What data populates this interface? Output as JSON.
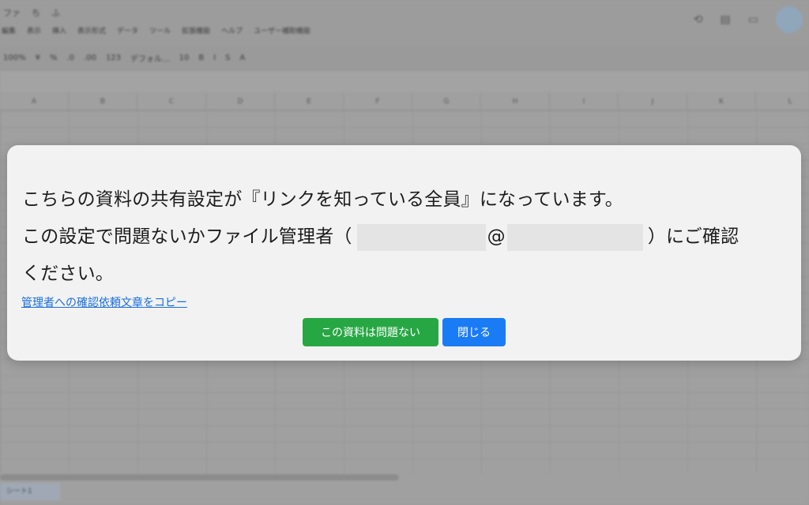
{
  "background": {
    "title_row": [
      "ファ",
      "ち",
      "ふ"
    ],
    "menu": [
      "編集",
      "表示",
      "挿入",
      "表示形式",
      "データ",
      "ツール",
      "拡張機能",
      "ヘルプ",
      "ユーザー補助機能"
    ],
    "toolbar": [
      "100%",
      "¥",
      "%",
      ".0",
      ".00",
      "123",
      "デフォル...",
      "10",
      "B",
      "I",
      "S",
      "A"
    ],
    "column_headers": [
      "A",
      "B",
      "C",
      "D",
      "E",
      "F",
      "G",
      "H",
      "I",
      "J",
      "K",
      "L"
    ],
    "sheet_tab": "シート1"
  },
  "dialog": {
    "line1": "こちらの資料の共有設定が『リンクを知っている全員』になっています。",
    "line2_prefix": "この設定で問題ないかファイル管理者（",
    "line2_at": "@",
    "line2_suffix": "）にご確認",
    "line3": "ください。",
    "copy_link": "管理者への確認依頼文章をコピー",
    "ok_button": "この資料は問題ない",
    "close_button": "閉じる",
    "colors": {
      "ok_button": "#27a744",
      "close_button": "#1a7cf5",
      "link": "#1a6fe0"
    }
  }
}
